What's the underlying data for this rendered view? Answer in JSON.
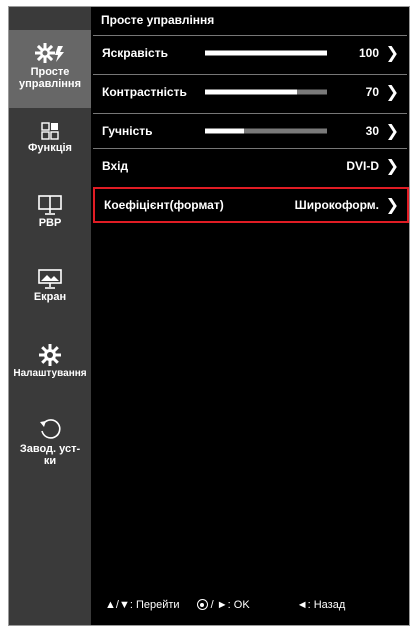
{
  "sidebar": {
    "items": [
      {
        "label": "Просте\nуправління",
        "icon": "gear-quick-icon",
        "active": true
      },
      {
        "label": "Функція",
        "icon": "function-grid-icon"
      },
      {
        "label": "PBP",
        "icon": "pbp-icon"
      },
      {
        "label": "Екран",
        "icon": "screen-icon"
      },
      {
        "label": "Налаштування",
        "icon": "gear-icon"
      },
      {
        "label": "Завод. уст-\nки",
        "icon": "reset-icon"
      }
    ]
  },
  "main": {
    "title": "Просте управління",
    "rows": [
      {
        "label": "Яскравість",
        "value": "100",
        "level": 1.0
      },
      {
        "label": "Контрастність",
        "value": "70",
        "level": 0.7
      },
      {
        "label": "Гучність",
        "value": "30",
        "level": 0.3
      },
      {
        "label": "Вхід",
        "value": "DVI-D"
      },
      {
        "label": "Коефіцієнт(формат)",
        "value": "Широкоформ.",
        "selected": true
      }
    ]
  },
  "footer": {
    "nav": "▲/▼: Перейти",
    "ok": "/ ►: OK",
    "back": "◄: Назад"
  },
  "colors": {
    "accent": "#e01c24",
    "sidebar": "#3a3a3a",
    "active": "#676767"
  }
}
